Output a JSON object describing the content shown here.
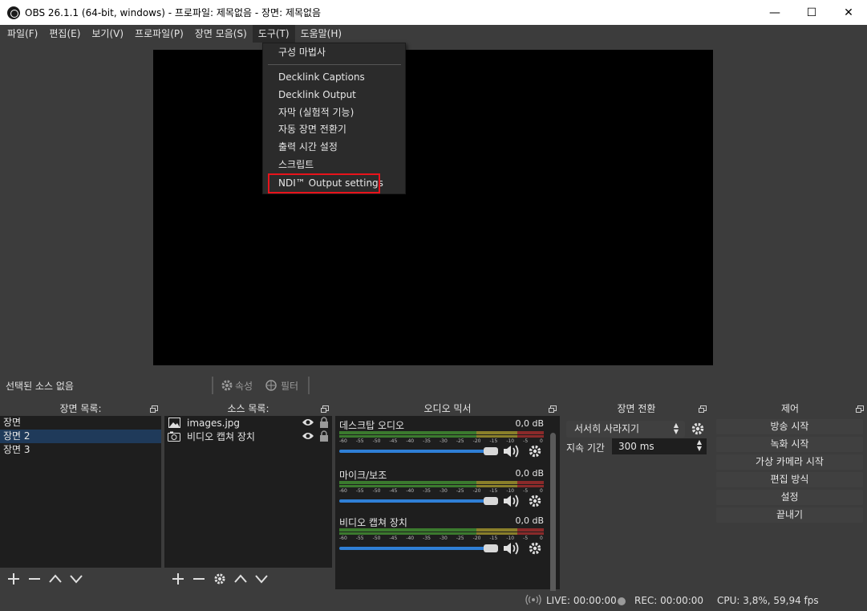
{
  "window": {
    "title": "OBS 26.1.1 (64-bit, windows) - 프로파일: 제목없음 - 장면: 제목없음",
    "minimize": "—",
    "maximize": "☐",
    "close": "✕"
  },
  "menubar": [
    "파일(F)",
    "편집(E)",
    "보기(V)",
    "프로파일(P)",
    "장면 모음(S)",
    "도구(T)",
    "도움말(H)"
  ],
  "tools_menu": {
    "items": [
      "구성 마법사",
      "Decklink Captions",
      "Decklink Output",
      "자막 (실험적 기능)",
      "자동 장면 전환기",
      "출력 시간 설정",
      "스크립트",
      "NDI™ Output settings"
    ],
    "highlighted": "NDI™ Output settings"
  },
  "context_bar": {
    "no_source": "선택된 소스 없음",
    "properties": "속성",
    "filters": "필터"
  },
  "scenes": {
    "header": "장면 목록:",
    "items": [
      "장면",
      "장면 2",
      "장면 3"
    ],
    "selected": "장면 2"
  },
  "sources": {
    "header": "소스 목록:",
    "items": [
      {
        "name": "images.jpg",
        "icon": "image-icon"
      },
      {
        "name": "비디오 캡쳐 장치",
        "icon": "camera-icon"
      }
    ]
  },
  "mixer": {
    "header": "오디오 믹서",
    "ticks": [
      "-60",
      "-55",
      "-50",
      "-45",
      "-40",
      "-35",
      "-30",
      "-25",
      "-20",
      "-15",
      "-10",
      "-5",
      "0"
    ],
    "channels": [
      {
        "name": "데스크탑 오디오",
        "db": "0,0 dB",
        "volume": 1.0
      },
      {
        "name": "마이크/보조",
        "db": "0,0 dB",
        "volume": 1.0
      },
      {
        "name": "비디오 캡쳐 장치",
        "db": "0,0 dB",
        "volume": 1.0
      }
    ]
  },
  "transitions": {
    "header": "장면 전환",
    "selected": "서서히 사라지기",
    "duration_label": "지속 기간",
    "duration_value": "300 ms"
  },
  "controls": {
    "header": "제어",
    "buttons": [
      "방송 시작",
      "녹화 시작",
      "가상 카메라 시작",
      "편집 방식",
      "설정",
      "끝내기"
    ]
  },
  "status": {
    "live": "LIVE: 00:00:00",
    "rec": "REC: 00:00:00",
    "cpu": "CPU: 3,8%, 59,94 fps"
  },
  "colors": {
    "background": "#3c3c3c",
    "panel": "#1e1e1e",
    "accent": "#2f7fd6",
    "highlight_box": "#e8131b"
  }
}
